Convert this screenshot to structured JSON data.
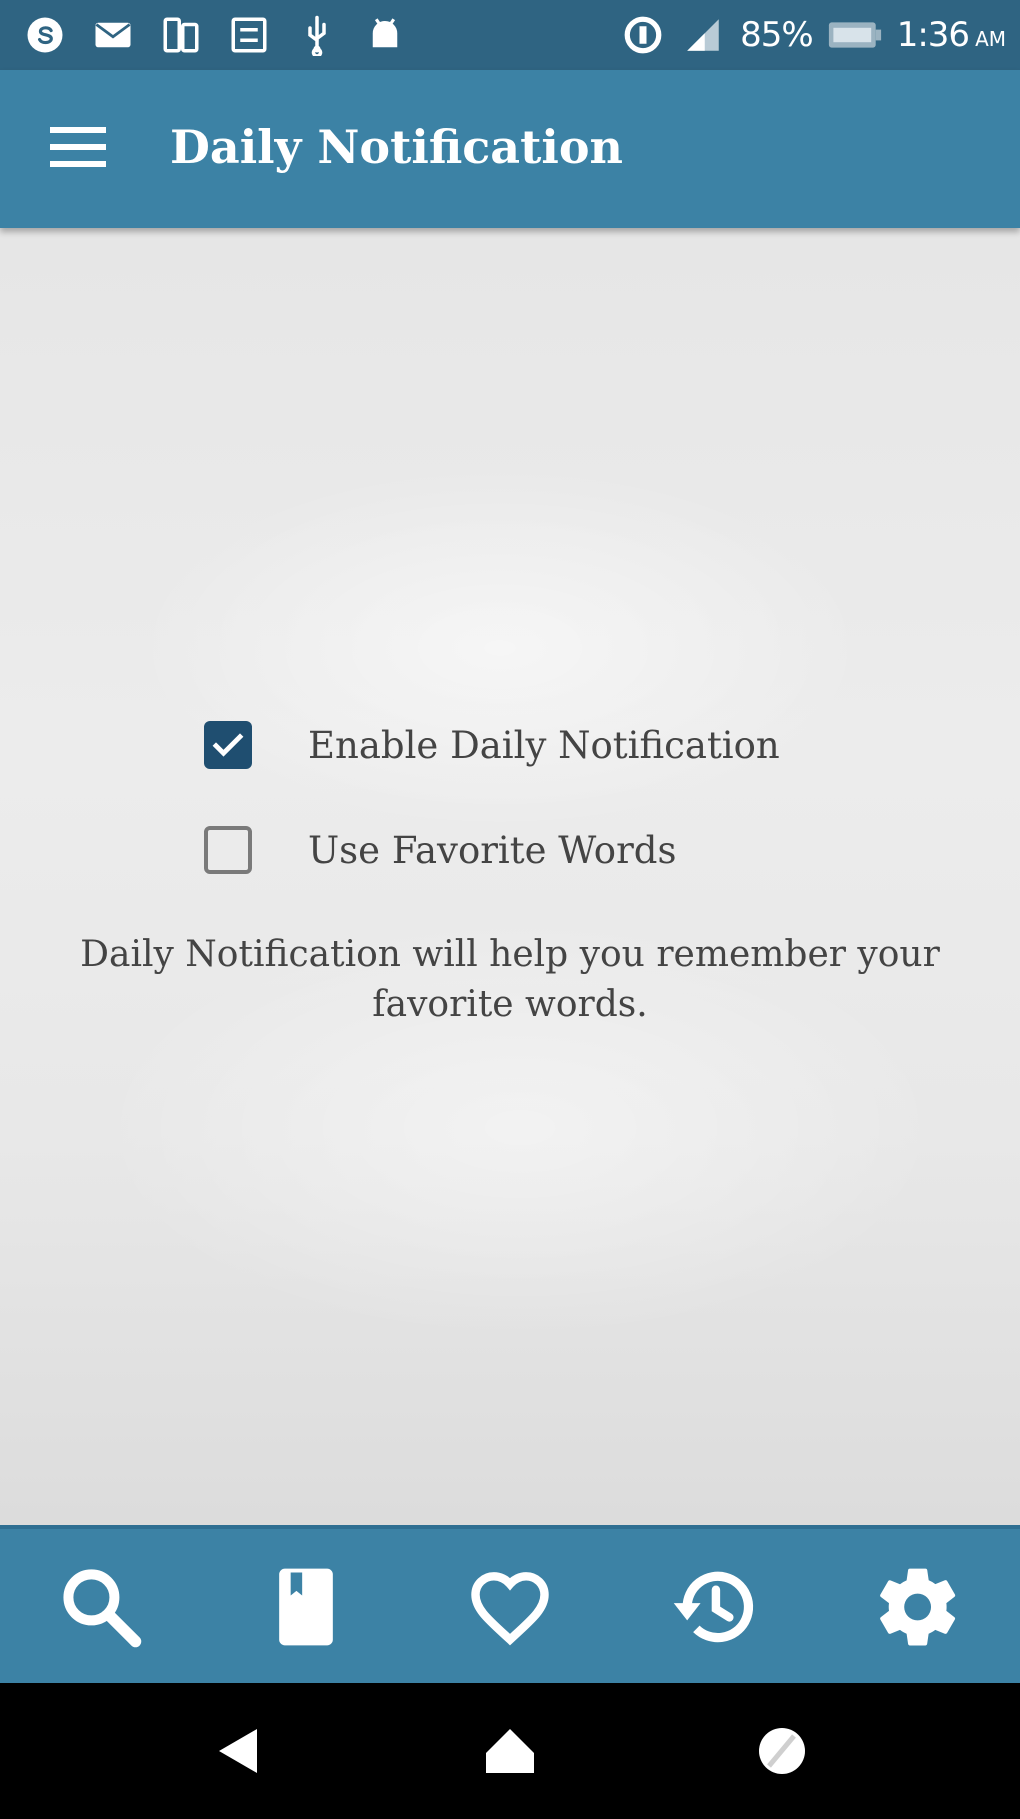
{
  "status_bar": {
    "battery_percent": "85%",
    "time": "1:36",
    "am_pm": "AM",
    "left_icons": [
      "skype-icon",
      "mail-icon",
      "dual-sim-icon",
      "screenshot-icon",
      "usb-icon",
      "android-icon"
    ],
    "right_icons": [
      "data-saver-icon",
      "signal-icon",
      "battery-icon"
    ]
  },
  "app_bar": {
    "title": "Daily Notification"
  },
  "options": {
    "enable_daily": {
      "label": "Enable Daily Notification",
      "checked": true
    },
    "use_favorites": {
      "label": "Use Favorite Words",
      "checked": false
    }
  },
  "help_text": "Daily Notification will help you remember your favorite words.",
  "bottom_nav": {
    "items": [
      "search-icon",
      "dictionary-book-icon",
      "heart-icon",
      "history-icon",
      "settings-gear-icon"
    ]
  },
  "colors": {
    "status_bar": "#2f6482",
    "app_bar": "#3c82a5",
    "checkbox_checked": "#1f4e70",
    "text": "#444444"
  }
}
